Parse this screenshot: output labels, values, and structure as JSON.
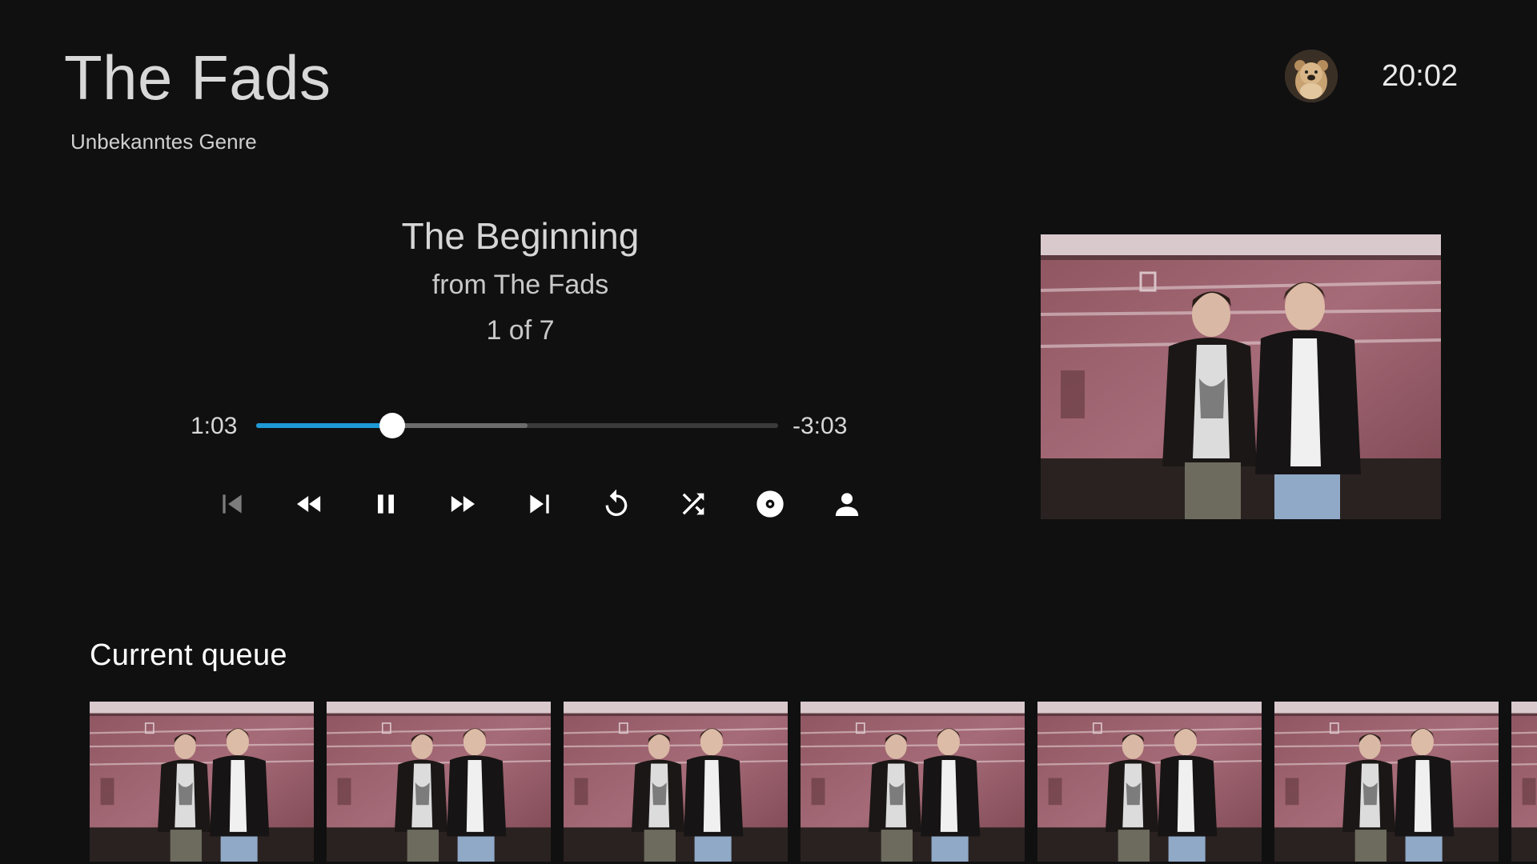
{
  "header": {
    "album_title": "The Fads",
    "genre": "Unbekanntes Genre",
    "clock": "20:02",
    "avatar_icon": "user-avatar-bear"
  },
  "now_playing": {
    "track_title": "The Beginning",
    "from_label": "from The Fads",
    "track_index": "1 of 7",
    "elapsed": "1:03",
    "remaining": "-3:03",
    "progress_fraction": 0.26,
    "buffered_fraction": 0.52,
    "accent_color": "#1e9ad6"
  },
  "controls": [
    {
      "icon": "skip-previous-icon",
      "disabled": true
    },
    {
      "icon": "rewind-icon",
      "disabled": false
    },
    {
      "icon": "pause-icon",
      "disabled": false
    },
    {
      "icon": "fast-forward-icon",
      "disabled": false
    },
    {
      "icon": "skip-next-icon",
      "disabled": false
    },
    {
      "icon": "repeat-icon",
      "disabled": false
    },
    {
      "icon": "shuffle-icon",
      "disabled": false
    },
    {
      "icon": "album-icon",
      "disabled": false
    },
    {
      "icon": "artist-icon",
      "disabled": false
    }
  ],
  "queue": {
    "heading": "Current queue",
    "item_count_visible": 7
  }
}
